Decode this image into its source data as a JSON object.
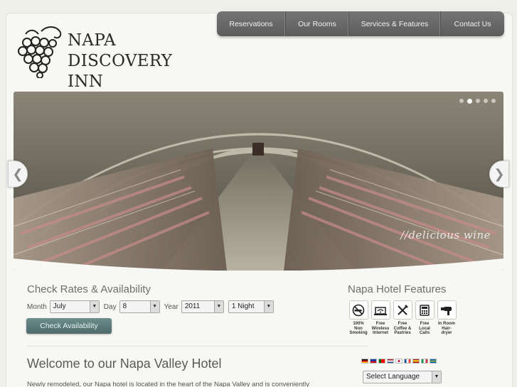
{
  "brand": {
    "line1": "NAPA",
    "line2": "DISCOVERY INN"
  },
  "nav": {
    "items": [
      {
        "label": "Reservations"
      },
      {
        "label": "Our Rooms"
      },
      {
        "label": "Services & Features"
      },
      {
        "label": "Contact Us"
      }
    ]
  },
  "hero": {
    "caption": "delicious wine",
    "slide_count": 5,
    "active_slide": 2,
    "prev_icon": "chevron-left-icon",
    "next_icon": "chevron-right-icon"
  },
  "rates": {
    "title": "Check Rates & Availability",
    "month_label": "Month",
    "month_value": "July",
    "day_label": "Day",
    "day_value": "8",
    "year_label": "Year",
    "year_value": "2011",
    "nights_value": "1 Night",
    "button_label": "Check Availability"
  },
  "features": {
    "title": "Napa Hotel Features",
    "items": [
      {
        "icon": "no-smoking-icon",
        "label": "100% Non Smoking"
      },
      {
        "icon": "laptop-wifi-icon",
        "label": "Free Wireless Internet"
      },
      {
        "icon": "utensils-icon",
        "label": "Free Coffee & Pastries"
      },
      {
        "icon": "phone-icon",
        "label": "Free Local Calls"
      },
      {
        "icon": "hairdryer-icon",
        "label": "In Room Hair-dryer"
      }
    ]
  },
  "welcome": {
    "title": "Welcome to our Napa Valley Hotel",
    "text": "Newly remodeled, our Napa hotel is located in the heart of the Napa Valley and is conveniently"
  },
  "language": {
    "select_label": "Select Language",
    "flags": [
      "german",
      "philippines",
      "portugal",
      "netherlands",
      "japan",
      "france",
      "spain",
      "italy",
      "sweden"
    ]
  },
  "colors": {
    "nav_bg": "#666666",
    "button_bg": "#5d7b7c",
    "page_bg": "#f7f7f3"
  }
}
